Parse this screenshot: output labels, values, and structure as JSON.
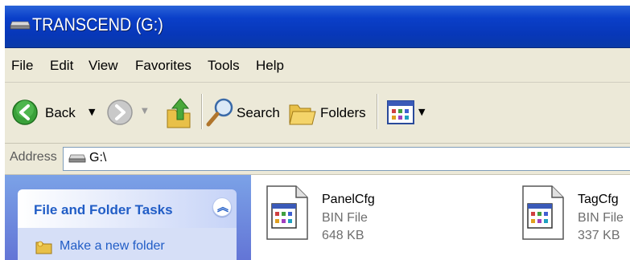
{
  "window": {
    "title": "TRANSCEND (G:)"
  },
  "menu": [
    "File",
    "Edit",
    "View",
    "Favorites",
    "Tools",
    "Help"
  ],
  "toolbar": {
    "back_label": "Back",
    "search_label": "Search",
    "folders_label": "Folders",
    "icons": [
      "back-arrow-icon",
      "forward-arrow-icon",
      "up-folder-icon",
      "search-magnifier-icon",
      "folders-icon",
      "views-icon"
    ]
  },
  "address": {
    "label": "Address",
    "value": "G:\\"
  },
  "task_pane": {
    "title": "File and Folder Tasks",
    "links": [
      "Make a new folder"
    ]
  },
  "files": [
    {
      "name": "PanelCfg",
      "type": "BIN File",
      "size": "648 KB"
    },
    {
      "name": "TagCfg",
      "type": "BIN File",
      "size": "337 KB"
    }
  ],
  "colors": {
    "titlebar": "#0a3fc9",
    "chrome": "#ece9d8",
    "taskpane": "#6f8fe0",
    "link": "#215dc6"
  }
}
